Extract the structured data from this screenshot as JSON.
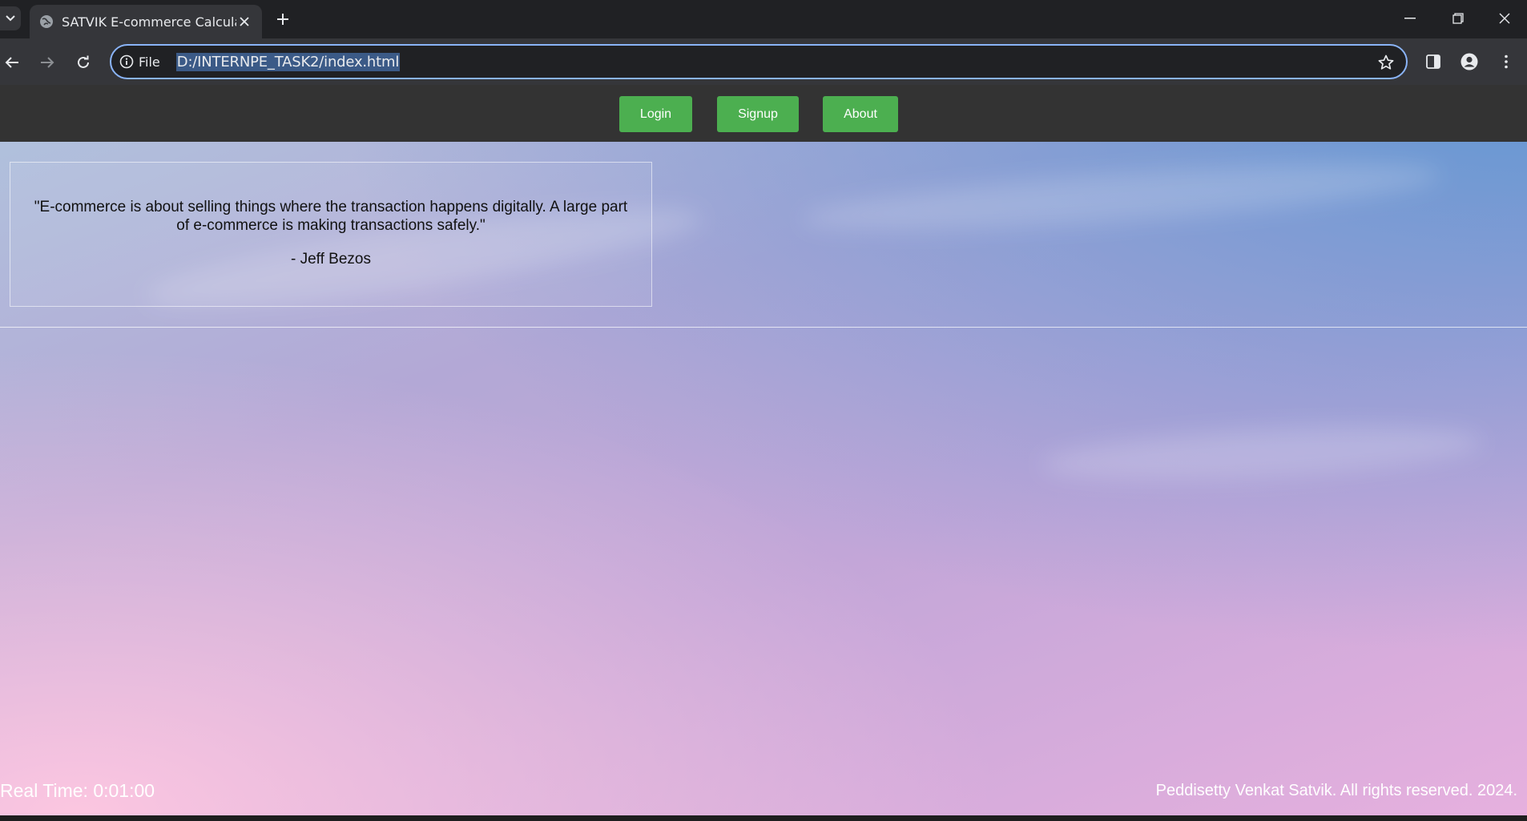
{
  "browser": {
    "tab_title": "SATVIK E-commerce Calculator",
    "site_info_label": "File",
    "url": "D:/INTERNPE_TASK2/index.html",
    "icons": [
      "chevron-down-icon",
      "globe-icon",
      "close-icon",
      "plus-icon",
      "minimize-icon",
      "restore-icon",
      "close-window-icon",
      "back-icon",
      "forward-icon",
      "reload-icon",
      "info-icon",
      "star-icon",
      "side-panel-icon",
      "profile-icon",
      "kebab-menu-icon"
    ]
  },
  "nav": {
    "login_label": "Login",
    "signup_label": "Signup",
    "about_label": "About"
  },
  "quote": {
    "text": "\"E-commerce is about selling things where the transaction happens digitally. A large part of e-commerce is making transactions safely.\"",
    "author": "- Jeff Bezos"
  },
  "footer": {
    "real_time": "Real Time: 0:01:00",
    "copyright": "Peddisetty Venkat Satvik. All rights reserved. 2024."
  },
  "colors": {
    "nav_bar": "#333333",
    "button": "#4caf50",
    "button_text": "#ffffff"
  }
}
